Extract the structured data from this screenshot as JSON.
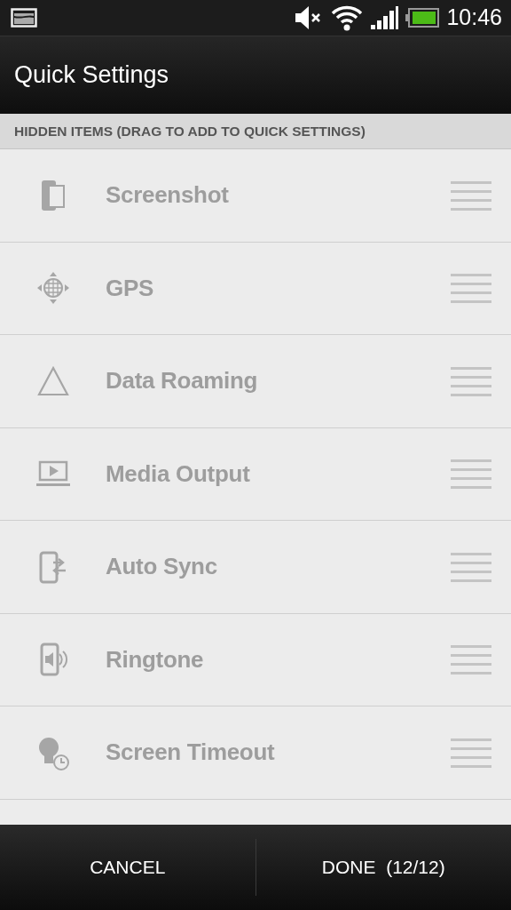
{
  "status_bar": {
    "time": "10:46"
  },
  "title": "Quick Settings",
  "section_header": "HIDDEN ITEMS (DRAG TO ADD TO QUICK SETTINGS)",
  "items": [
    {
      "label": "Screenshot",
      "kind": "screenshot"
    },
    {
      "label": "GPS",
      "kind": "gps"
    },
    {
      "label": "Data Roaming",
      "kind": "roaming"
    },
    {
      "label": "Media Output",
      "kind": "media"
    },
    {
      "label": "Auto Sync",
      "kind": "sync"
    },
    {
      "label": "Ringtone",
      "kind": "ringtone"
    },
    {
      "label": "Screen Timeout",
      "kind": "timeout"
    }
  ],
  "buttons": [
    {
      "label": "CANCEL"
    },
    {
      "label": "DONE  (12/12)"
    }
  ]
}
